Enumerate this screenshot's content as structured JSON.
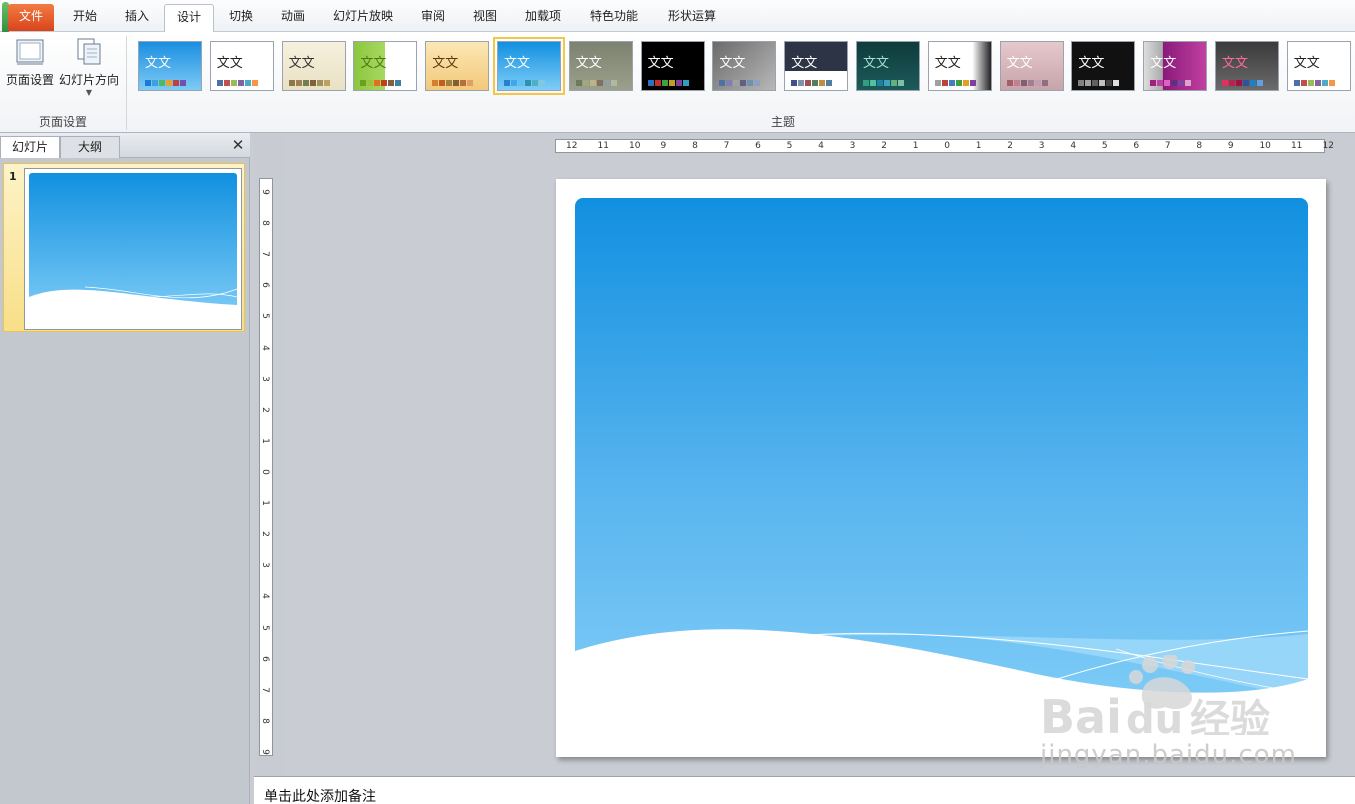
{
  "menu": {
    "file": "文件",
    "tabs": [
      "开始",
      "插入",
      "设计",
      "切换",
      "动画",
      "幻灯片放映",
      "审阅",
      "视图",
      "加载项",
      "特色功能",
      "形状运算"
    ],
    "active_tab": "设计"
  },
  "ribbon": {
    "page_setup_label": "页面设置",
    "slide_orientation_label": "幻灯片方向",
    "group_page_setup": "页面设置",
    "group_theme": "主题",
    "theme_sample_text": "文文",
    "themes_count": 17,
    "selected_theme_index": 5
  },
  "left_pane": {
    "tab_slides": "幻灯片",
    "tab_outline": "大纲",
    "close_symbol": "✕",
    "slide_number": "1"
  },
  "rulers": {
    "horizontal": [
      "12",
      "11",
      "10",
      "9",
      "8",
      "7",
      "6",
      "5",
      "4",
      "3",
      "2",
      "1",
      "0",
      "1",
      "2",
      "3",
      "4",
      "5",
      "6",
      "7",
      "8",
      "9",
      "10",
      "11",
      "12"
    ],
    "vertical": [
      "9",
      "8",
      "7",
      "6",
      "5",
      "4",
      "3",
      "2",
      "1",
      "0",
      "1",
      "2",
      "3",
      "4",
      "5",
      "6",
      "7",
      "8",
      "9"
    ]
  },
  "notes": {
    "placeholder": "单击此处添加备注"
  },
  "watermark": {
    "text": "jingyan.baidu.com",
    "logo": "Baidu经验"
  },
  "colors": {
    "file_tab": "#e2532a",
    "slide_gradient_top": "#1190e0",
    "slide_gradient_bottom": "#7fcdf7",
    "selected_highlight": "#f2c84b"
  }
}
